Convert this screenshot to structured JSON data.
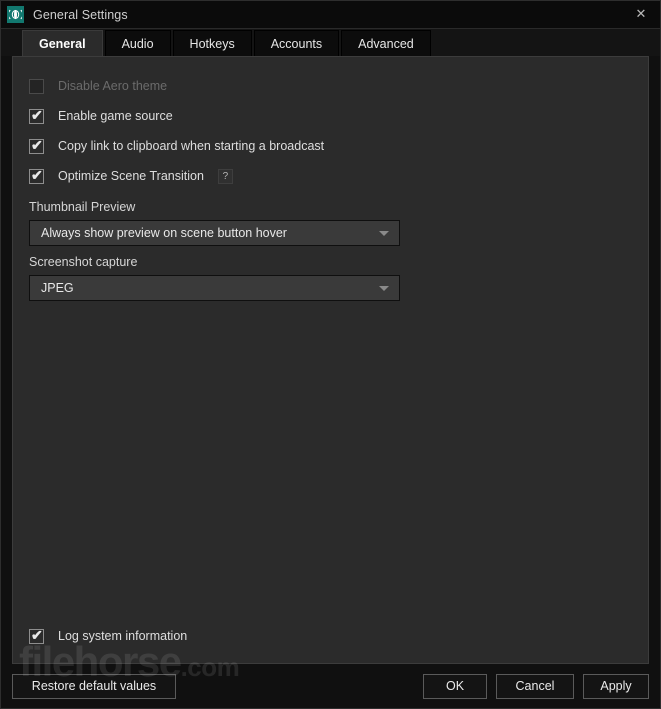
{
  "window": {
    "title": "General Settings",
    "app_icon": "broadcast-wave-icon",
    "close_label": "✕",
    "accent_color": "#12786f",
    "panel_bg": "#2b2b2b",
    "window_bg": "#101010"
  },
  "tabs": [
    {
      "label": "General",
      "selected": true
    },
    {
      "label": "Audio",
      "selected": false
    },
    {
      "label": "Hotkeys",
      "selected": false
    },
    {
      "label": "Accounts",
      "selected": false
    },
    {
      "label": "Advanced",
      "selected": false
    }
  ],
  "checkboxes": [
    {
      "label": "Disable Aero theme",
      "checked": false,
      "disabled": true,
      "help": false
    },
    {
      "label": "Enable game source",
      "checked": true,
      "disabled": false,
      "help": false
    },
    {
      "label": "Copy link to clipboard when starting a broadcast",
      "checked": true,
      "disabled": false,
      "help": false
    },
    {
      "label": "Optimize Scene Transition",
      "checked": true,
      "disabled": false,
      "help": true,
      "help_label": "?"
    }
  ],
  "fields": [
    {
      "label": "Thumbnail Preview",
      "value": "Always show preview on scene button hover",
      "icon": "chevron-down-icon"
    },
    {
      "label": "Screenshot capture",
      "value": "JPEG",
      "icon": "chevron-down-icon"
    }
  ],
  "log_option": {
    "label": "Log system information",
    "checked": true
  },
  "watermark": {
    "text": "filehorse",
    "suffix": ".com"
  },
  "footer": {
    "restore_label": "Restore default values",
    "ok_label": "OK",
    "cancel_label": "Cancel",
    "apply_label": "Apply"
  },
  "check_glyph": "✔"
}
